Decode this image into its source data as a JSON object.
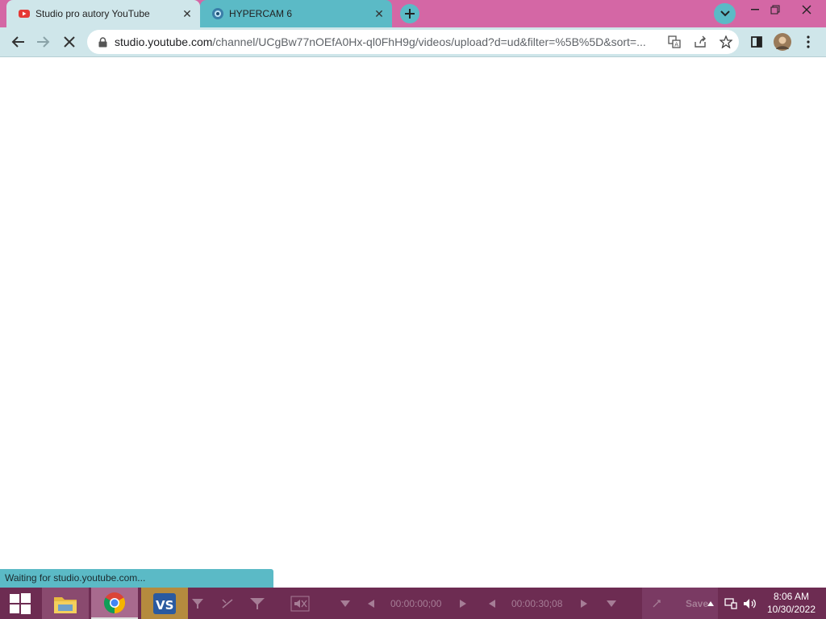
{
  "browser": {
    "tabs": [
      {
        "title": "Studio pro autory YouTube",
        "active": true,
        "favicon": "youtube-studio-icon"
      },
      {
        "title": "HYPERCAM 6",
        "active": false,
        "favicon": "hypercam-icon"
      }
    ],
    "address": {
      "host": "studio.youtube.com",
      "path": "/channel/UCgBw77nOEfA0Hx-ql0FhH9g/videos/upload?d=ud&filter=%5B%5D&sort=..."
    },
    "status_text": "Waiting for studio.youtube.com..."
  },
  "hypercam": {
    "time_start": "00:00:00;00",
    "time_end": "00:00:30;08",
    "save_label": "Save"
  },
  "taskbar": {
    "apps": [
      "start-icon",
      "file-explorer-icon",
      "chrome-icon",
      "vs-icon"
    ],
    "clock": {
      "time": "8:06 AM",
      "date": "10/30/2022"
    }
  },
  "colors": {
    "title_bar": "#d467a5",
    "active_tab": "#cfe6ea",
    "inactive_tab": "#5bbac6",
    "taskbar": "#6d2c52"
  }
}
